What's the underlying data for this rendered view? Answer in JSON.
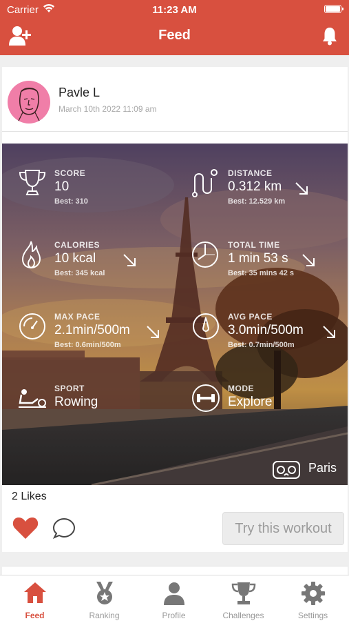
{
  "status": {
    "carrier": "Carrier",
    "time": "11:23 AM"
  },
  "header": {
    "title": "Feed"
  },
  "post": {
    "user": "Pavle L",
    "date": "March 10th 2022 11:09 am",
    "stats": {
      "score": {
        "label": "SCORE",
        "value": "10",
        "best": "Best: 310"
      },
      "distance": {
        "label": "DISTANCE",
        "value": "0.312 km",
        "best": "Best: 12.529 km"
      },
      "calories": {
        "label": "CALORIES",
        "value": "10 kcal",
        "best": "Best: 345 kcal"
      },
      "total_time": {
        "label": "TOTAL TIME",
        "value": "1 min 53 s",
        "best": "Best: 35 mins 42 s"
      },
      "max_pace": {
        "label": "MAX PACE",
        "value": "2.1min/500m",
        "best": "Best: 0.6min/500m"
      },
      "avg_pace": {
        "label": "AVG PACE",
        "value": "3.0min/500m",
        "best": "Best: 0.7min/500m"
      },
      "sport": {
        "label": "SPORT",
        "value": "Rowing"
      },
      "mode": {
        "label": "MODE",
        "value": "Explore"
      }
    },
    "location": "Paris",
    "likes": "2 Likes",
    "try_button": "Try this workout"
  },
  "tabs": [
    {
      "label": "Feed"
    },
    {
      "label": "Ranking"
    },
    {
      "label": "Profile"
    },
    {
      "label": "Challenges"
    },
    {
      "label": "Settings"
    }
  ],
  "colors": {
    "accent": "#d8503f",
    "inactive_tab": "#999999"
  }
}
